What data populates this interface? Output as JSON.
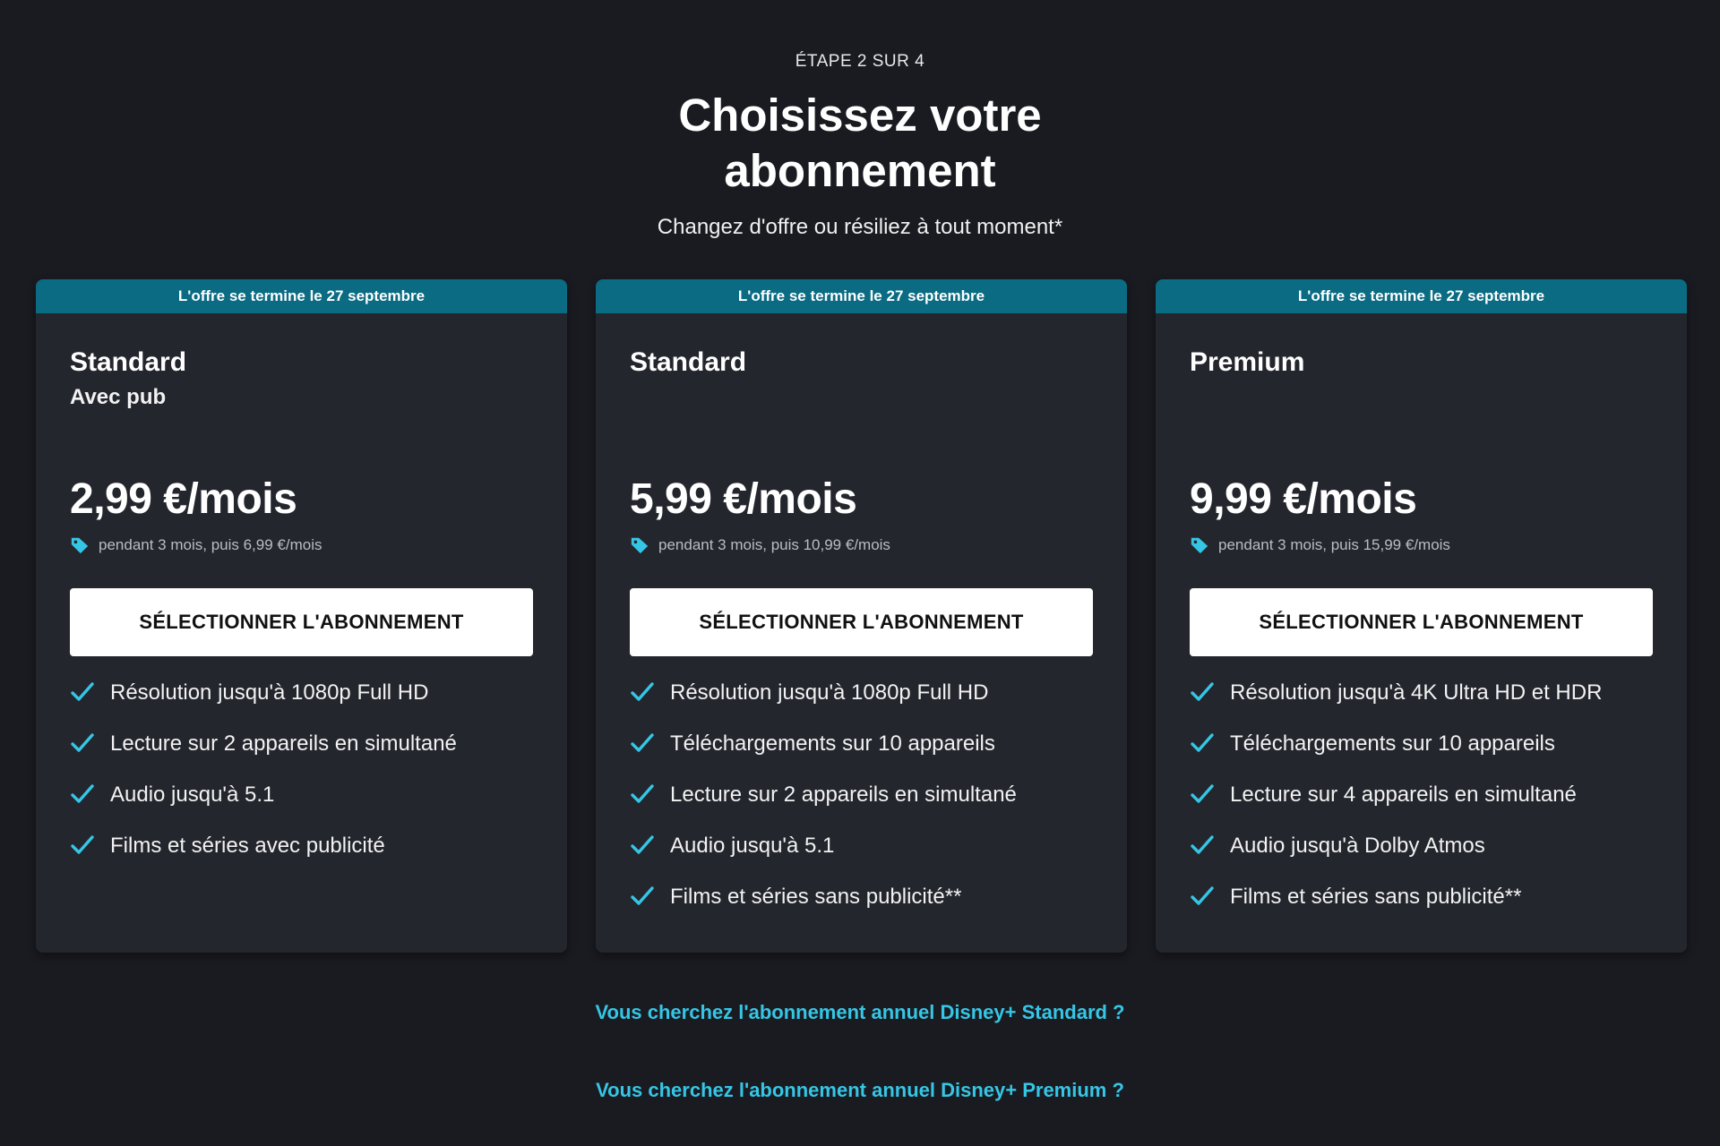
{
  "header": {
    "step": "ÉTAPE 2 SUR 4",
    "title_line1": "Choisissez votre",
    "title_line2": "abonnement",
    "subtitle": "Changez d'offre ou résiliez à tout moment*"
  },
  "colors": {
    "background": "#1a1b21",
    "card": "#24262e",
    "banner": "#0a6b83",
    "accent": "#35c6e6",
    "button": "#ffffff"
  },
  "icons": {
    "promo": "price-tag-icon",
    "feature": "checkmark-icon"
  },
  "plans": [
    {
      "banner": "L'offre se termine le 27 septembre",
      "name": "Standard",
      "subtitle": "Avec pub",
      "price": "2,99 €/mois",
      "promo": "pendant 3 mois, puis 6,99 €/mois",
      "button": "SÉLECTIONNER L'ABONNEMENT",
      "features": [
        "Résolution jusqu'à 1080p Full HD",
        "Lecture sur 2 appareils en simultané",
        "Audio jusqu'à 5.1",
        "Films et séries avec publicité"
      ]
    },
    {
      "banner": "L'offre se termine le 27 septembre",
      "name": "Standard",
      "subtitle": "",
      "price": "5,99 €/mois",
      "promo": "pendant 3 mois, puis 10,99 €/mois",
      "button": "SÉLECTIONNER L'ABONNEMENT",
      "features": [
        "Résolution jusqu'à 1080p Full HD",
        "Téléchargements sur 10 appareils",
        "Lecture sur 2 appareils en simultané",
        "Audio jusqu'à 5.1",
        "Films et séries sans publicité**"
      ]
    },
    {
      "banner": "L'offre se termine le 27 septembre",
      "name": "Premium",
      "subtitle": "",
      "price": "9,99 €/mois",
      "promo": "pendant 3 mois, puis 15,99 €/mois",
      "button": "SÉLECTIONNER L'ABONNEMENT",
      "features": [
        "Résolution jusqu'à 4K Ultra HD et HDR",
        "Téléchargements sur 10 appareils",
        "Lecture sur 4 appareils en simultané",
        "Audio jusqu'à Dolby Atmos",
        "Films et séries sans publicité**"
      ]
    }
  ],
  "links": {
    "annual_standard": "Vous cherchez l'abonnement annuel Disney+ Standard ?",
    "annual_premium": "Vous cherchez l'abonnement annuel Disney+ Premium ?"
  }
}
